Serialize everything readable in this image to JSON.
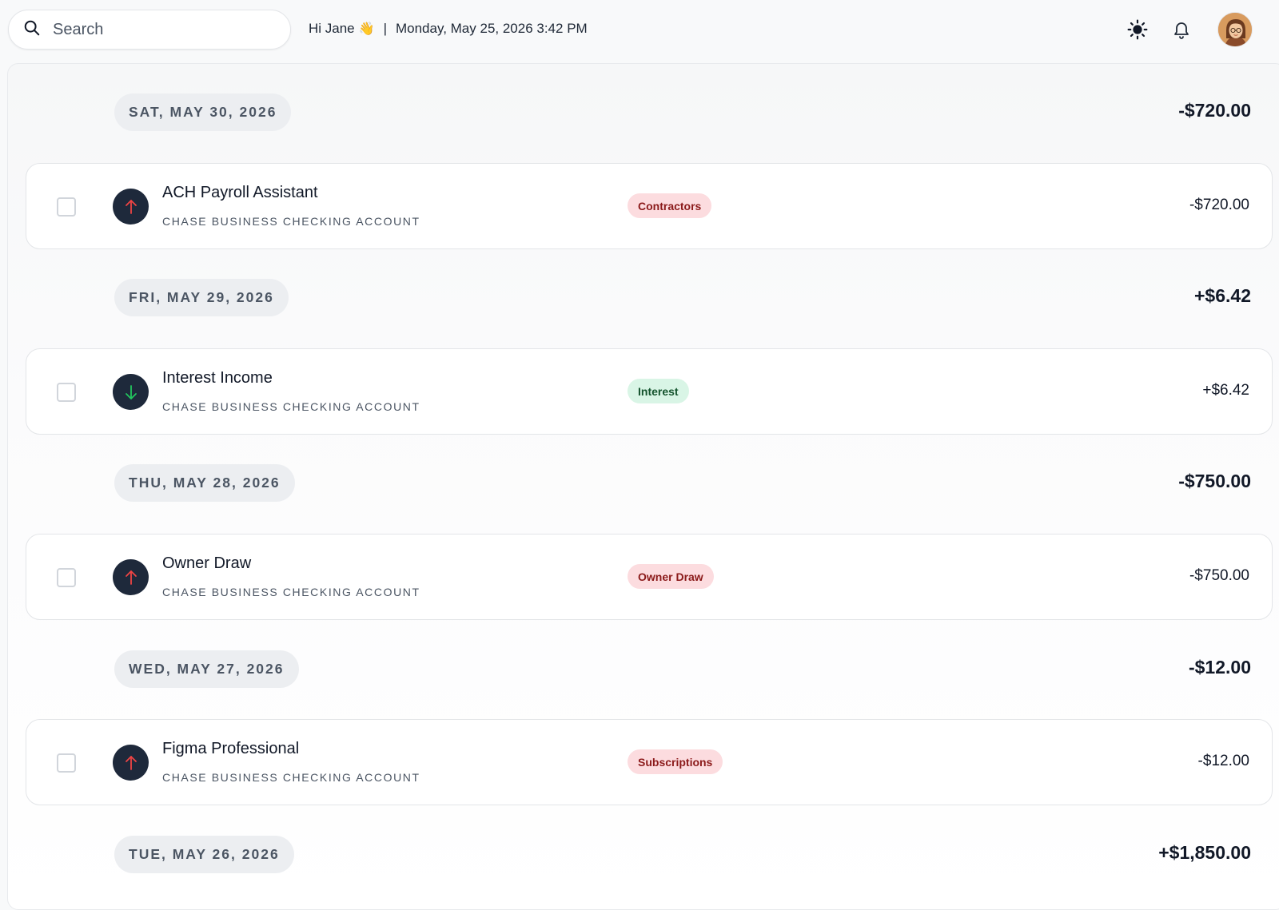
{
  "header": {
    "search_placeholder": "Search",
    "greeting": "Hi Jane",
    "greeting_emoji": "👋",
    "separator": "|",
    "datetime": "Monday, May 25, 2026 3:42 PM"
  },
  "colors": {
    "debit_arrow": "#ef4444",
    "credit_arrow": "#22c55e",
    "icon_bg": "#1e293b",
    "tag_red_bg": "#fcdcdf",
    "tag_green_bg": "#d9f5e6"
  },
  "groups": [
    {
      "date": "SAT, MAY 30, 2026",
      "total": "-$720.00",
      "txn": {
        "name": "ACH Payroll Assistant",
        "account": "CHASE BUSINESS CHECKING ACCOUNT",
        "category": "Contractors",
        "amount": "-$720.00",
        "direction": "up-arrow-icon"
      }
    },
    {
      "date": "FRI, MAY 29, 2026",
      "total": "+$6.42",
      "txn": {
        "name": "Interest Income",
        "account": "CHASE BUSINESS CHECKING ACCOUNT",
        "category": "Interest",
        "amount": "+$6.42",
        "direction": "down-arrow-icon"
      }
    },
    {
      "date": "THU, MAY 28, 2026",
      "total": "-$750.00",
      "txn": {
        "name": "Owner Draw",
        "account": "CHASE BUSINESS CHECKING ACCOUNT",
        "category": "Owner Draw",
        "amount": "-$750.00",
        "direction": "up-arrow-icon"
      }
    },
    {
      "date": "WED, MAY 27, 2026",
      "total": "-$12.00",
      "txn": {
        "name": "Figma Professional",
        "account": "CHASE BUSINESS CHECKING ACCOUNT",
        "category": "Subscriptions",
        "amount": "-$12.00",
        "direction": "up-arrow-icon"
      }
    },
    {
      "date": "TUE, MAY 26, 2026",
      "total": "+$1,850.00"
    }
  ]
}
